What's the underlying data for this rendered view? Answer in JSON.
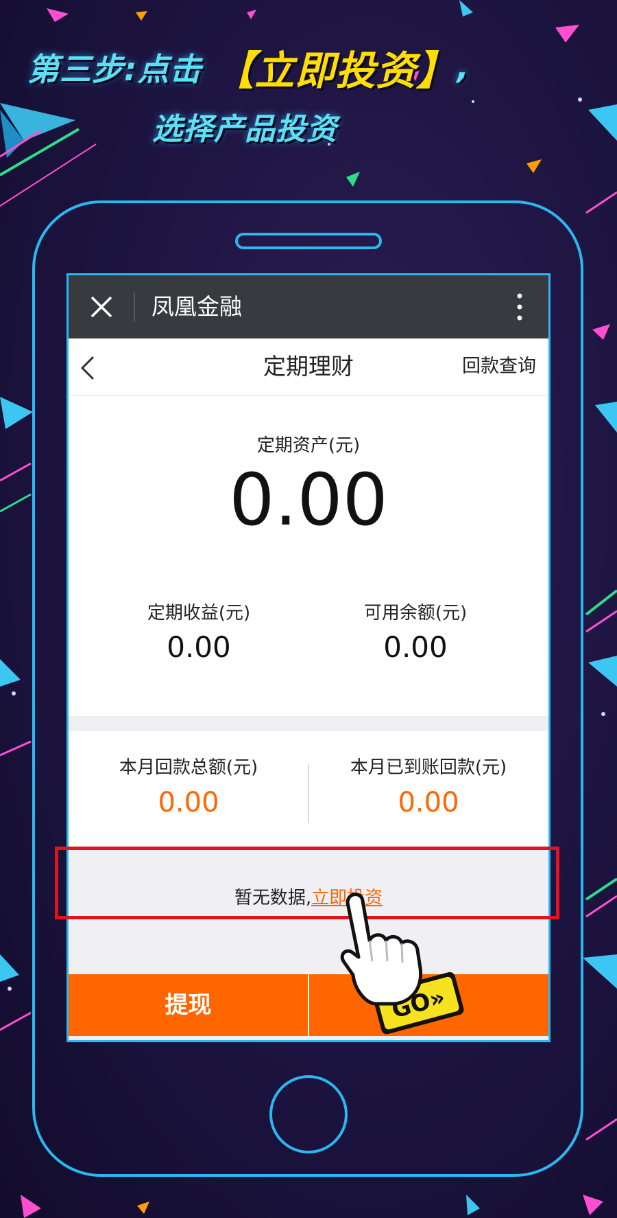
{
  "banner": {
    "step_label": "第三步:点击",
    "highlight": "【立即投资】",
    "comma": ",",
    "line2": "选择产品投资"
  },
  "wechat_bar": {
    "title": "凤凰金融",
    "close_icon": "close-icon",
    "more_icon": "more-vertical-icon"
  },
  "nav": {
    "back_icon": "back-chevron-icon",
    "title": "定期理财",
    "right_link": "回款查询"
  },
  "summary": {
    "asset_label": "定期资产(元)",
    "asset_value": "0.00",
    "income_label": "定期收益(元)",
    "income_value": "0.00",
    "balance_label": "可用余额(元)",
    "balance_value": "0.00"
  },
  "monthly": {
    "total_label": "本月回款总额(元)",
    "total_value": "0.00",
    "received_label": "本月已到账回款(元)",
    "received_value": "0.00"
  },
  "empty_state": {
    "text": "暂无数据,",
    "link": "立即投资"
  },
  "actions": {
    "withdraw": "提现"
  },
  "pointer": {
    "badge": "GO»"
  },
  "colors": {
    "accent": "#ff6600",
    "phone_outline": "#29b8f0",
    "highlight_box": "#e2131c",
    "heading": "#5ee0f4",
    "heading_highlight": "#ffde00"
  }
}
